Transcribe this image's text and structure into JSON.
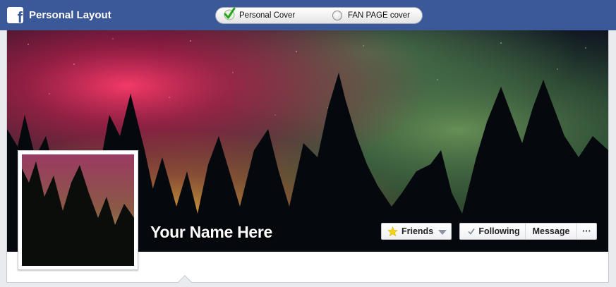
{
  "header": {
    "title": "Personal Layout",
    "logo_icon": "facebook-logo-icon",
    "brand_color": "#3b5998"
  },
  "cover_toggle": {
    "options": [
      {
        "label": "Personal Cover",
        "selected": true,
        "icon": "checkmark-icon"
      },
      {
        "label": "FAN PAGE cover",
        "selected": false,
        "icon": "radio-icon"
      }
    ]
  },
  "profile": {
    "name": "Your Name Here"
  },
  "actions": {
    "friends_label": "Friends",
    "following_label": "Following",
    "message_label": "Message",
    "more_label": "···"
  }
}
